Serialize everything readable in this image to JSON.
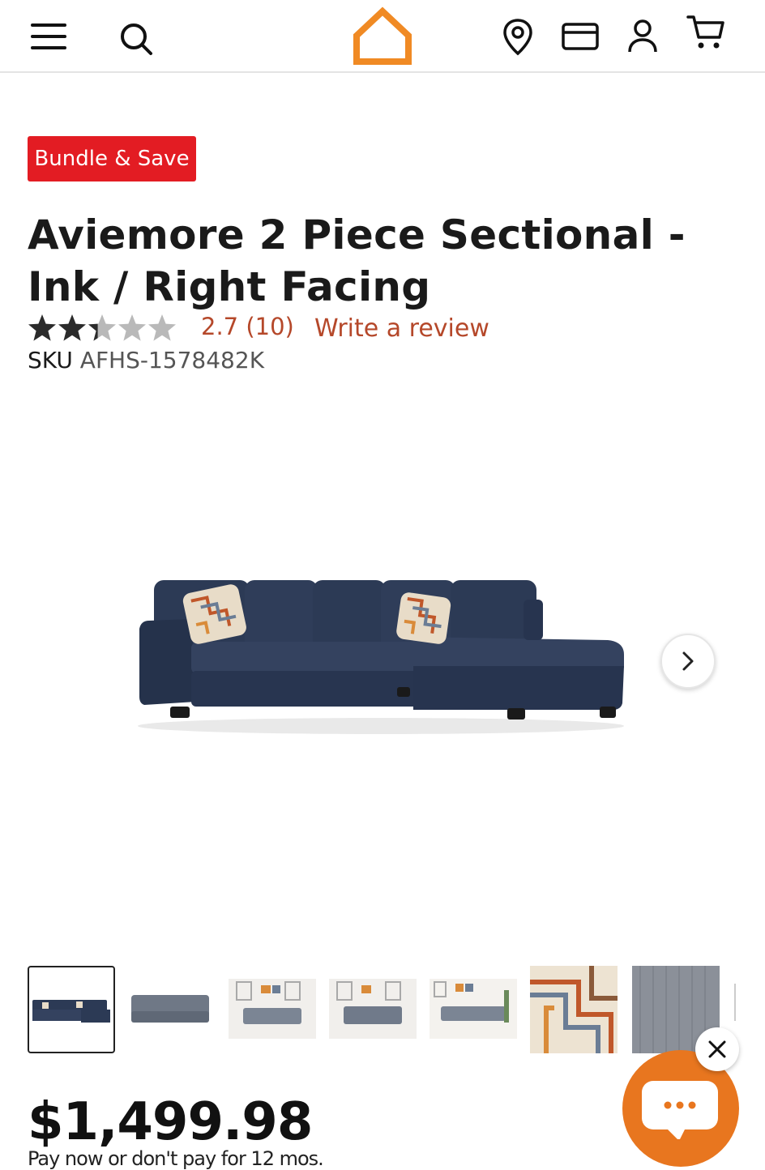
{
  "header": {
    "icons": [
      "menu-icon",
      "search-icon",
      "home-logo",
      "location-pin-icon",
      "credit-card-icon",
      "account-icon",
      "cart-icon"
    ],
    "logo_color": "#f08a24"
  },
  "product": {
    "badge": "Bundle & Save",
    "title": "Aviemore 2 Piece Sectional - Ink / Right Facing",
    "rating": 2.7,
    "rating_text": "2.7",
    "review_count_text": "(10)",
    "write_review": "Write a review",
    "sku_label": "SKU",
    "sku_value": "AFHS-1578482K",
    "price": "$1,499.98",
    "financing_text": "Pay now or don't pay for 12 mos."
  },
  "gallery": {
    "selected_index": 0,
    "thumbnail_count": 7
  },
  "colors": {
    "badge_red": "#e31c23",
    "link_rust": "#b5482a",
    "chat_orange": "#e8761f",
    "sofa_navy": "#27344f"
  }
}
